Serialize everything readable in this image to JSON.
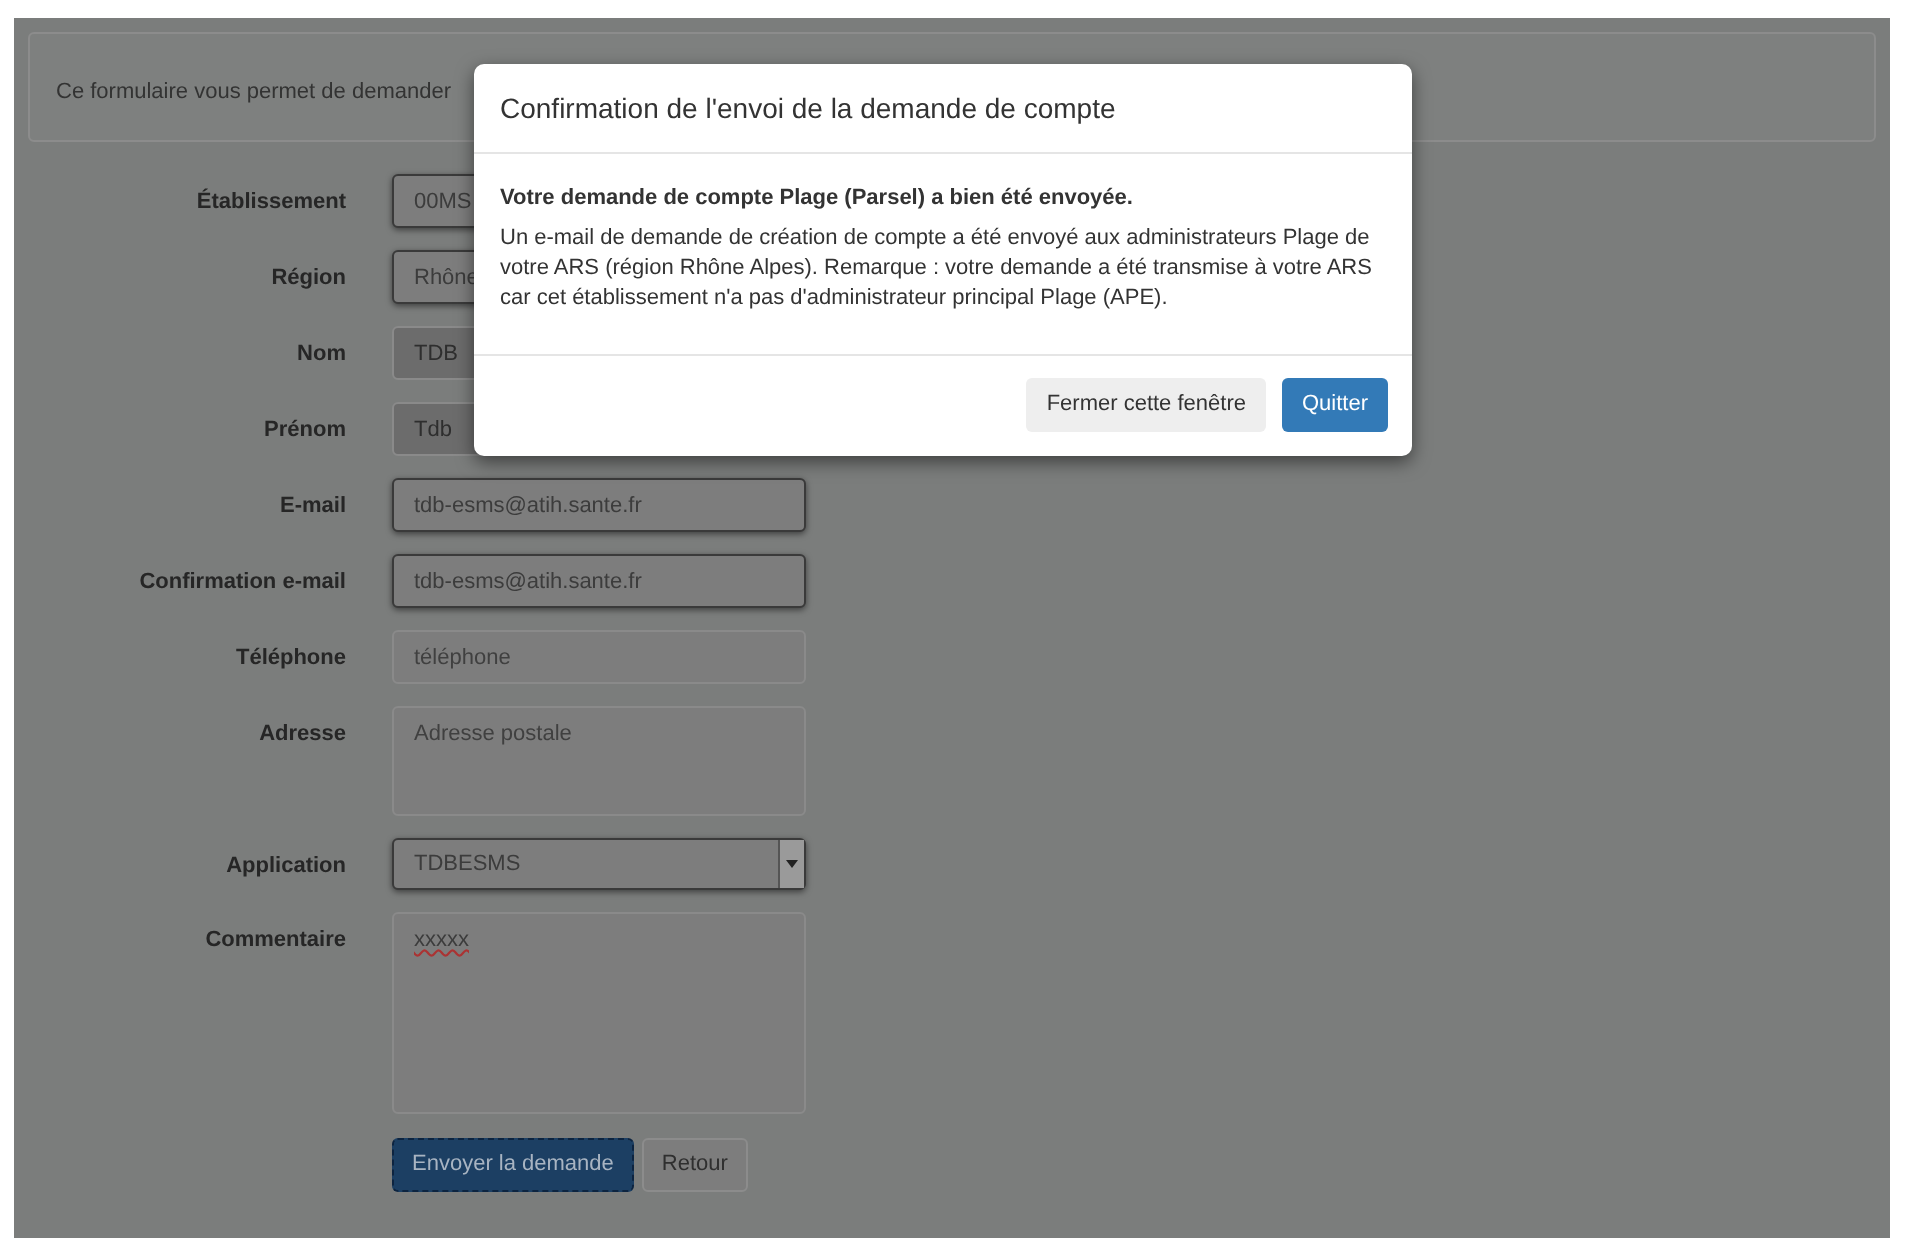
{
  "intro": "Ce formulaire vous permet de demander",
  "fields": [
    {
      "label": "Établissement",
      "kind": "text",
      "value": "00MS",
      "outlined": true,
      "disabled": false
    },
    {
      "label": "Région",
      "kind": "text",
      "value": "Rhône",
      "outlined": true,
      "disabled": false
    },
    {
      "label": "Nom",
      "kind": "text",
      "value": "TDB",
      "outlined": false,
      "disabled": true
    },
    {
      "label": "Prénom",
      "kind": "text",
      "value": "Tdb",
      "outlined": false,
      "disabled": true
    },
    {
      "label": "E-mail",
      "kind": "text",
      "value": "tdb-esms@atih.sante.fr",
      "outlined": true,
      "disabled": false
    },
    {
      "label": "Confirmation e-mail",
      "kind": "text",
      "value": "tdb-esms@atih.sante.fr",
      "outlined": true,
      "disabled": false
    },
    {
      "label": "Téléphone",
      "kind": "text",
      "placeholder": "téléphone",
      "outlined": false,
      "disabled": false
    },
    {
      "label": "Adresse",
      "kind": "textarea",
      "placeholder": "Adresse postale",
      "outlined": false,
      "disabled": false
    },
    {
      "label": "Application",
      "kind": "select",
      "value": "TDBESMS",
      "outlined": true,
      "disabled": false
    },
    {
      "label": "Commentaire",
      "kind": "comment",
      "value": "xxxxx",
      "outlined": false,
      "disabled": false
    }
  ],
  "buttons": [
    {
      "label": "Envoyer la demande",
      "primary": true
    },
    {
      "label": "Retour",
      "primary": false
    }
  ],
  "modal": {
    "title": "Confirmation de l'envoi de la demande de compte",
    "heading": "Votre demande de compte Plage (Parsel) a bien été envoyée.",
    "message": "Un e-mail de demande de création de compte a été envoyé aux administrateurs Plage de votre ARS (région Rhône Alpes). Remarque : votre demande a été transmise à votre ARS car cet établissement n'a pas d'administrateur principal Plage (APE).",
    "buttons": [
      {
        "label": "Fermer cette fenêtre",
        "primary": false
      },
      {
        "label": "Quitter",
        "primary": true
      }
    ]
  }
}
